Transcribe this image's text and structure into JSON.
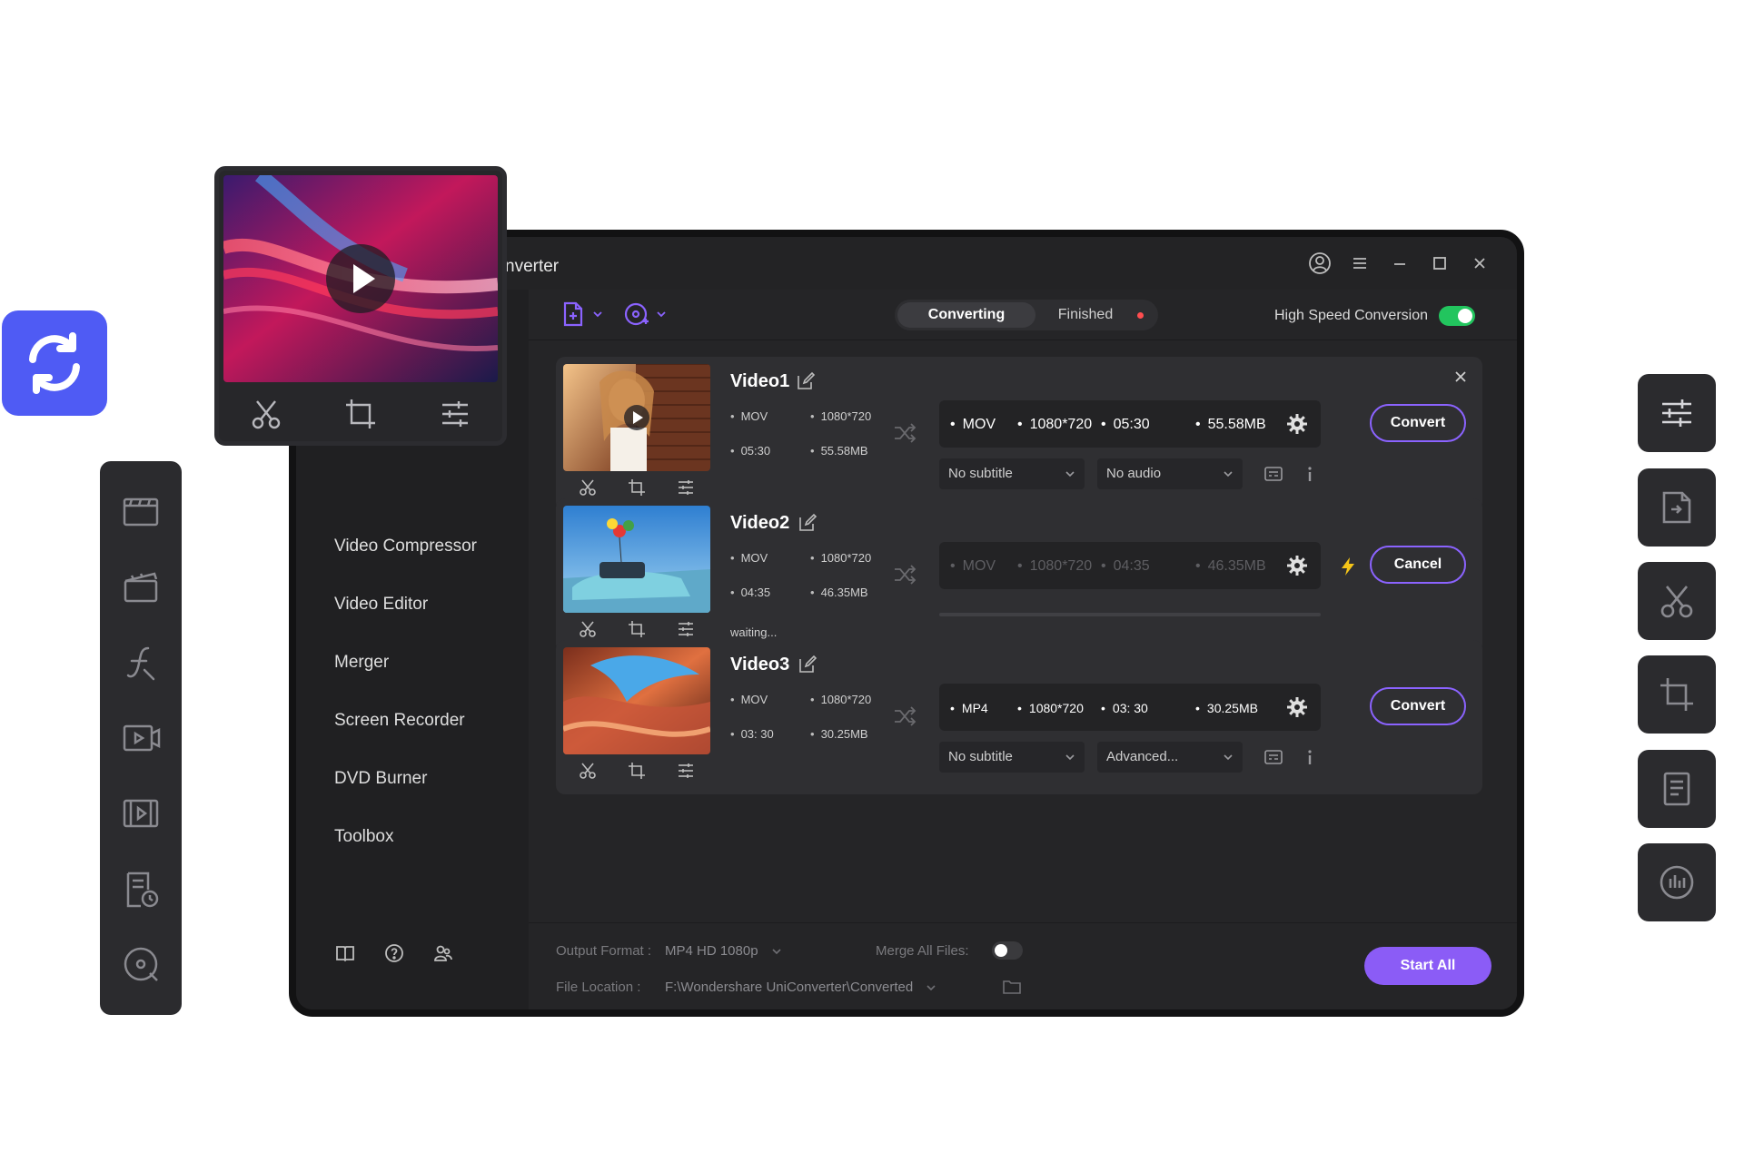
{
  "window": {
    "title": "nverter",
    "controls": [
      "account-icon",
      "menu-icon",
      "minimize-icon",
      "maximize-icon",
      "close-icon"
    ]
  },
  "toolbar": {
    "add_files_icon": "add-file-icon",
    "load_icon": "add-disc-icon",
    "tabs": [
      {
        "label": "Converting",
        "active": true
      },
      {
        "label": "Finished",
        "active": false,
        "badge": "red-dot"
      }
    ],
    "high_speed": {
      "label": "High Speed Conversion",
      "enabled": true
    }
  },
  "sidebar": {
    "items": [
      {
        "label": "Video Compressor"
      },
      {
        "label": "Video Editor"
      },
      {
        "label": "Merger"
      },
      {
        "label": "Screen Recorder"
      },
      {
        "label": "DVD Burner"
      },
      {
        "label": "Toolbox"
      }
    ],
    "footer_icons": [
      "guide-book-icon",
      "help-icon",
      "community-icon"
    ]
  },
  "videos": [
    {
      "name": "Video1",
      "src_format": "MOV",
      "src_resolution": "1080*720",
      "src_duration": "05:30",
      "src_size": "55.58MB",
      "out_format": "MOV",
      "out_resolution": "1080*720",
      "out_duration": "05:30",
      "out_size": "55.58MB",
      "subtitle": "No subtitle",
      "audio": "No audio",
      "action": "Convert"
    },
    {
      "name": "Video2",
      "src_format": "MOV",
      "src_resolution": "1080*720",
      "src_duration": "04:35",
      "src_size": "46.35MB",
      "out_format": "MOV",
      "out_resolution": "1080*720",
      "out_duration": "04:35",
      "out_size": "46.35MB",
      "status": "waiting...",
      "progress": 0,
      "action": "Cancel"
    },
    {
      "name": "Video3",
      "src_format": "MOV",
      "src_resolution": "1080*720",
      "src_duration": "03: 30",
      "src_size": "30.25MB",
      "out_format": "MP4",
      "out_resolution": "1080*720",
      "out_duration": "03: 30",
      "out_size": "30.25MB",
      "subtitle": "No subtitle",
      "audio": "Advanced...",
      "action": "Convert"
    }
  ],
  "footer": {
    "output_format_label": "Output Format :",
    "output_format_value": "MP4 HD 1080p",
    "merge_label": "Merge All Files:",
    "merge_enabled": false,
    "file_location_label": "File Location :",
    "file_location_value": "F:\\Wondershare UniConverter\\Converted",
    "start_all": "Start All"
  },
  "left_rail_icons": [
    "converter-icon",
    "dvd-clapper-icon",
    "script-icon",
    "screen-record-icon",
    "film-strip-icon",
    "document-clock-icon",
    "disc-icon"
  ],
  "right_rail_icons": [
    "adjust-sliders-icon",
    "export-file-icon",
    "scissors-icon",
    "crop-icon",
    "document-icon",
    "audio-meter-icon"
  ],
  "colors": {
    "accent": "#8b5cf6",
    "logo": "#4f5bf4",
    "toggle_on": "#22c55e",
    "badge": "#ff4d4f",
    "bolt": "#f5c518",
    "window_bg": "#232325"
  }
}
